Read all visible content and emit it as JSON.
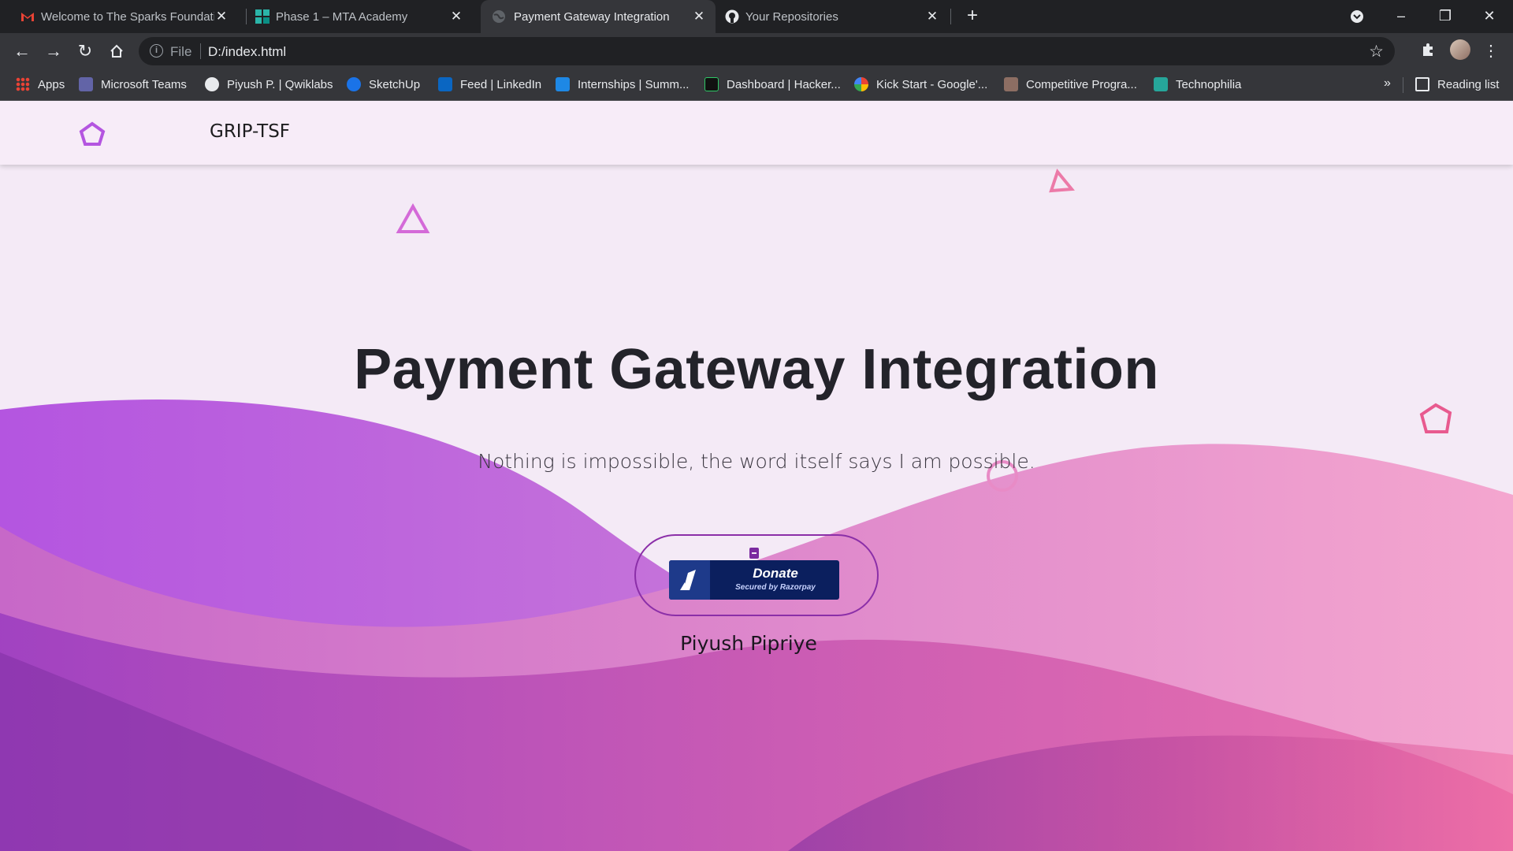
{
  "tabs": [
    {
      "title": "Welcome to The Sparks Foundati",
      "icon": "gmail-icon",
      "active": false
    },
    {
      "title": "Phase 1 – MTA Academy",
      "icon": "mta-academy-icon",
      "active": false
    },
    {
      "title": "Payment Gateway Integration",
      "icon": "globe-icon",
      "active": true
    },
    {
      "title": "Your Repositories",
      "icon": "github-icon",
      "active": false
    }
  ],
  "toolbar": {
    "file_label": "File",
    "url": "D:/index.html"
  },
  "bookmarks": [
    {
      "label": "Apps",
      "icon": "apps-grid-icon",
      "color": "#ea4335"
    },
    {
      "label": "Microsoft Teams",
      "icon": "teams-icon",
      "color": "#6264a7"
    },
    {
      "label": "Piyush P. | Qwiklabs",
      "icon": "globe-icon",
      "color": "#e8eaed"
    },
    {
      "label": "SketchUp",
      "icon": "sketchup-icon",
      "color": "#1a73e8"
    },
    {
      "label": "Feed | LinkedIn",
      "icon": "linkedin-icon",
      "color": "#0a66c2"
    },
    {
      "label": "Internships | Summ...",
      "icon": "internshala-icon",
      "color": "#1e88e5"
    },
    {
      "label": "Dashboard | Hacker...",
      "icon": "hackerrank-icon",
      "color": "#111111"
    },
    {
      "label": "Kick Start - Google'...",
      "icon": "google-icon",
      "color": "#ffffff"
    },
    {
      "label": "Competitive Progra...",
      "icon": "codechef-icon",
      "color": "#8d6e63"
    },
    {
      "label": "Technophilia",
      "icon": "technophilia-icon",
      "color": "#26a69a"
    }
  ],
  "reading_list": "Reading list",
  "site": {
    "brand": "GRIP-TSF",
    "title": "Payment Gateway Integration",
    "subtitle": "Nothing is impossible, the word itself says I am possible.",
    "donate_label": "Donate",
    "donate_secure": "Secured by Razorpay",
    "author": "Piyush Pipriye"
  },
  "colors": {
    "accent": "#8b2fa8",
    "wave_purple": "#b455e0",
    "wave_pink": "#ec6ba6",
    "razorpay_navy": "#0b1f5e"
  }
}
